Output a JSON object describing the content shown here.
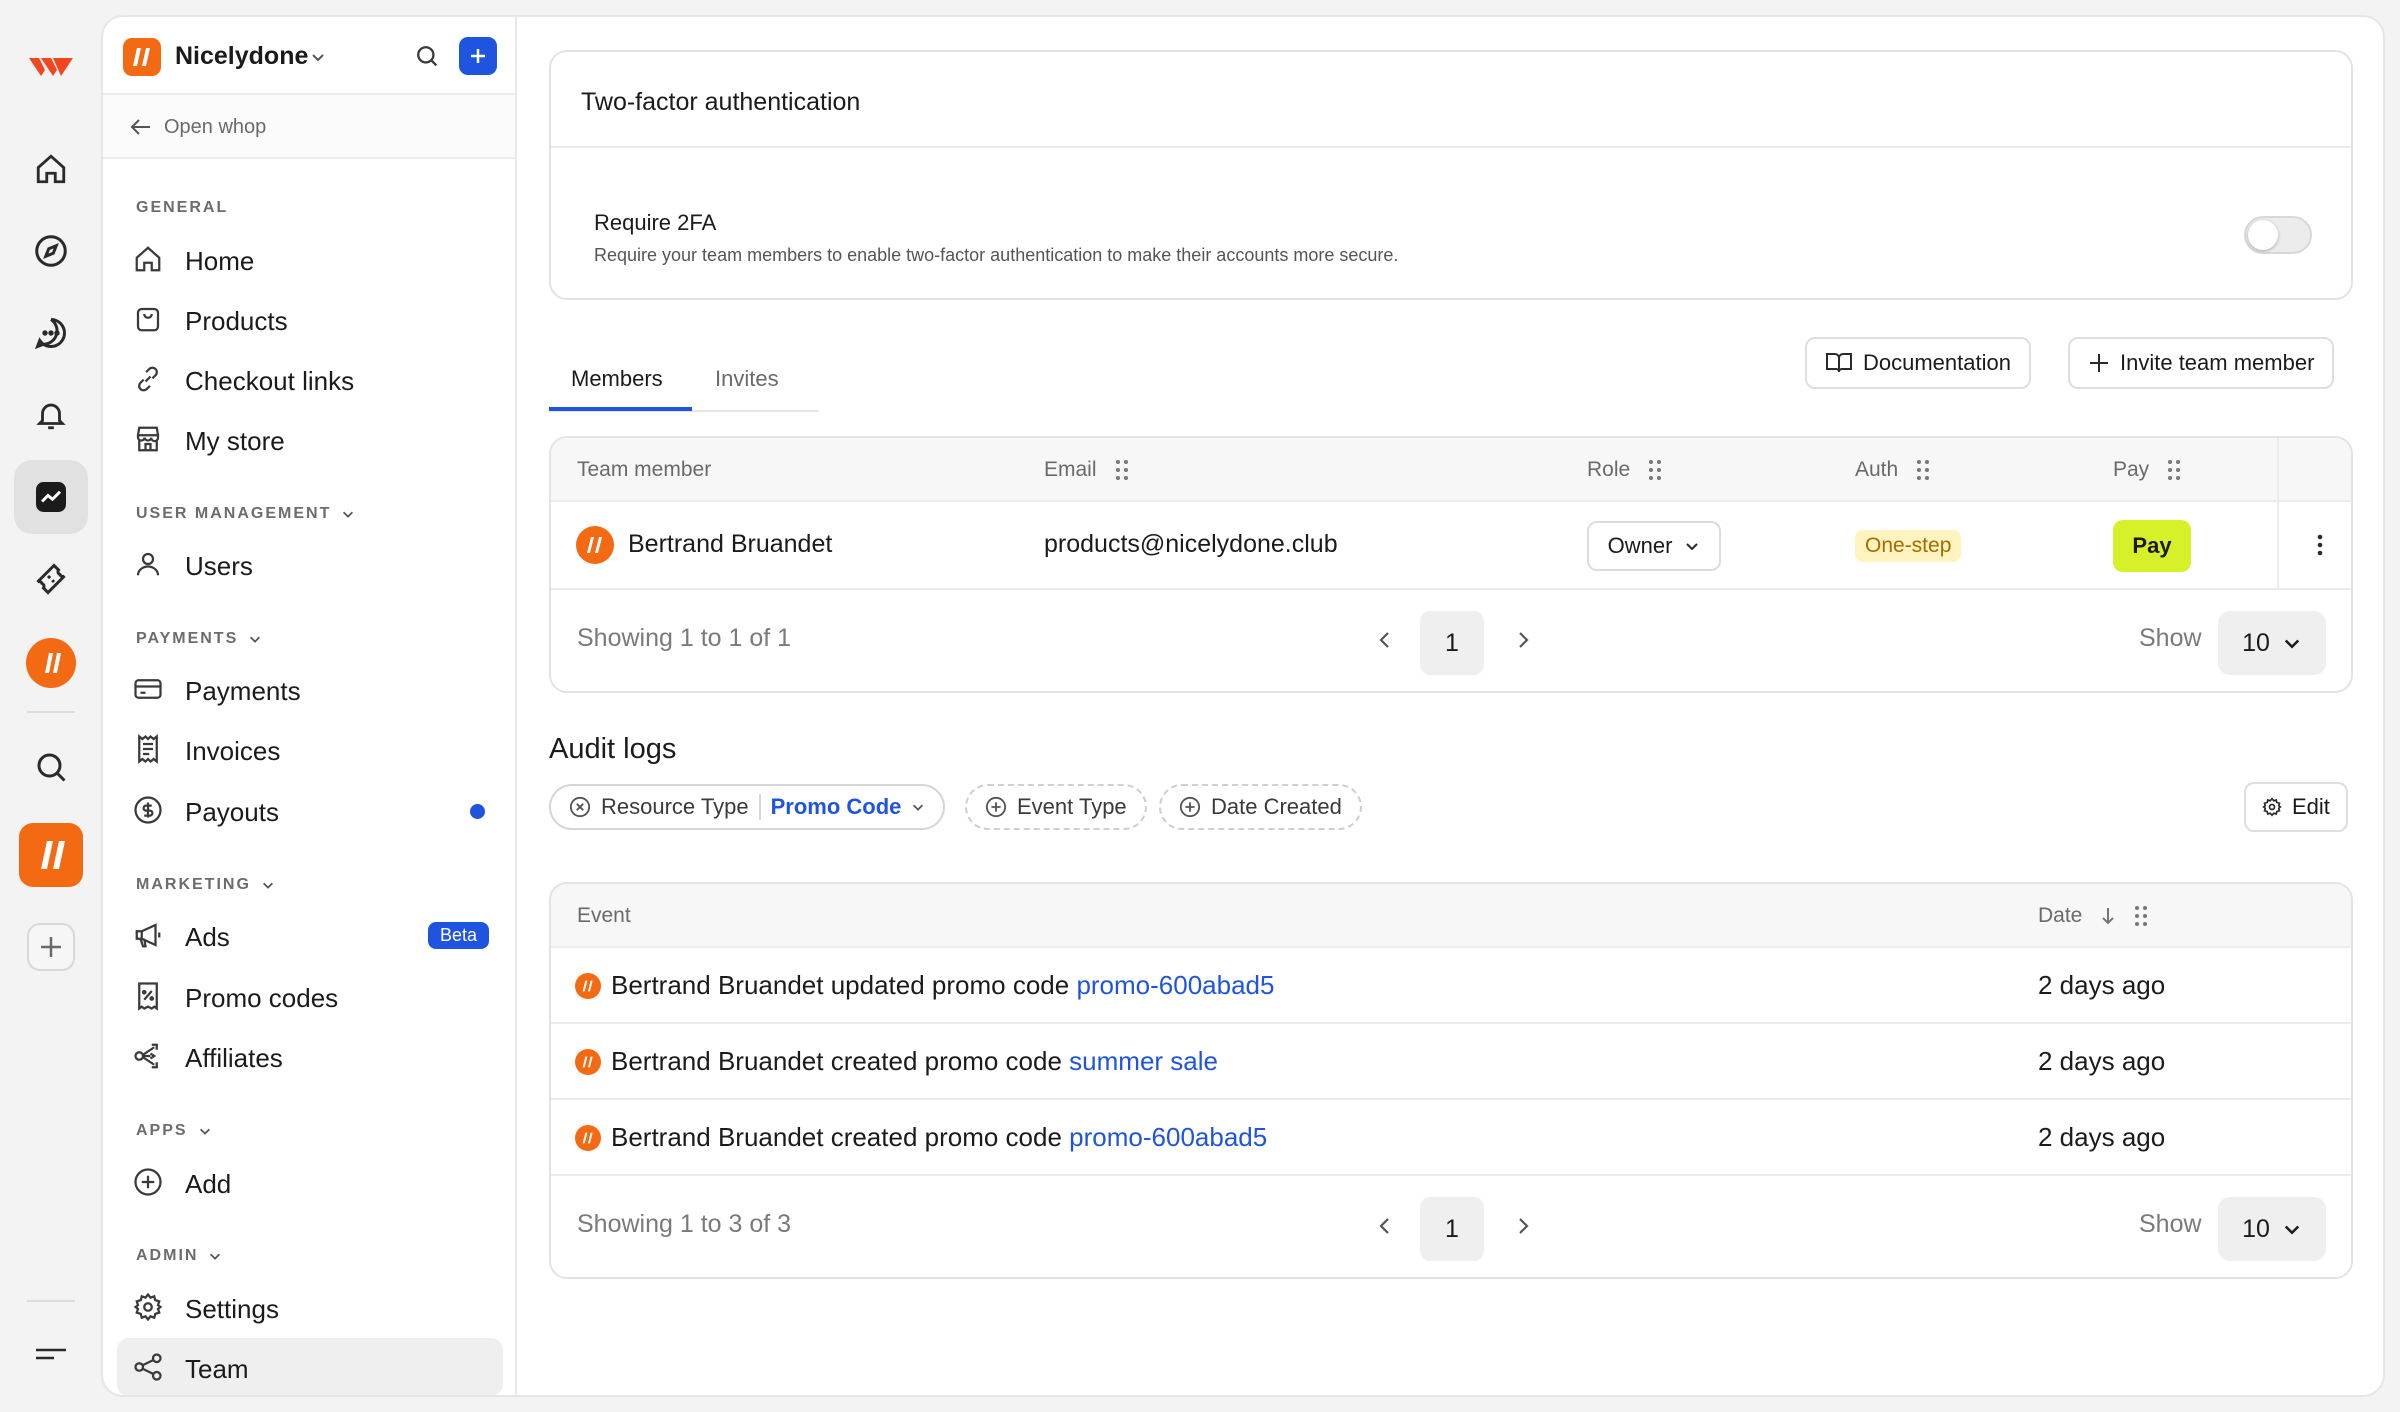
{
  "rail": {
    "items": [
      "whop-logo-icon",
      "home-icon",
      "compass-icon",
      "chat-icon",
      "bell-icon",
      "dashboard-icon",
      "ticket-icon",
      "user-avatar-icon",
      "search-icon",
      "nicelydone-app-icon",
      "add-icon",
      "menu-icon"
    ]
  },
  "sidebar": {
    "workspace_name": "Nicelydone",
    "open_whop": "Open whop",
    "sections": {
      "general": "GENERAL",
      "user_management": "USER MANAGEMENT",
      "payments": "PAYMENTS",
      "marketing": "MARKETING",
      "apps": "APPS",
      "admin": "ADMIN"
    },
    "items": {
      "home": "Home",
      "products": "Products",
      "checkout_links": "Checkout links",
      "my_store": "My store",
      "users": "Users",
      "payments": "Payments",
      "invoices": "Invoices",
      "payouts": "Payouts",
      "ads": "Ads",
      "ads_badge": "Beta",
      "promo_codes": "Promo codes",
      "affiliates": "Affiliates",
      "add": "Add",
      "settings": "Settings",
      "team": "Team"
    },
    "active_item": "Team"
  },
  "twofa": {
    "title": "Two-factor authentication",
    "label": "Require 2FA",
    "description": "Require your team members to enable two-factor authentication to make their accounts more secure.",
    "enabled": false
  },
  "tabs": {
    "members": "Members",
    "invites": "Invites",
    "active": "Members"
  },
  "actions": {
    "documentation": "Documentation",
    "invite": "Invite team member"
  },
  "members_table": {
    "headers": {
      "member": "Team member",
      "email": "Email",
      "role": "Role",
      "auth": "Auth",
      "pay": "Pay"
    },
    "rows": [
      {
        "name": "Bertrand Bruandet",
        "email": "products@nicelydone.club",
        "role": "Owner",
        "auth": "One-step",
        "pay": "Pay"
      }
    ],
    "pager": {
      "summary": "Showing 1 to 1 of 1",
      "page": "1",
      "show_label": "Show",
      "page_size": "10"
    }
  },
  "audit": {
    "title": "Audit logs",
    "filters": {
      "resource_type": "Resource Type",
      "resource_value": "Promo Code",
      "event_type": "Event Type",
      "date_created": "Date Created",
      "edit": "Edit"
    },
    "headers": {
      "event": "Event",
      "date": "Date"
    },
    "rows": [
      {
        "actor": "Bertrand Bruandet",
        "action": " updated promo code ",
        "target": "promo-600abad5",
        "date": "2 days ago"
      },
      {
        "actor": "Bertrand Bruandet",
        "action": " created promo code ",
        "target": "summer sale",
        "date": "2 days ago"
      },
      {
        "actor": "Bertrand Bruandet",
        "action": " created promo code ",
        "target": "promo-600abad5",
        "date": "2 days ago"
      }
    ],
    "pager": {
      "summary": "Showing 1 to 3 of 3",
      "page": "1",
      "show_label": "Show",
      "page_size": "10"
    }
  },
  "colors": {
    "accent_blue": "#1f54e0",
    "brand_orange": "#f36a12",
    "pay_lime": "#d6f12a"
  }
}
